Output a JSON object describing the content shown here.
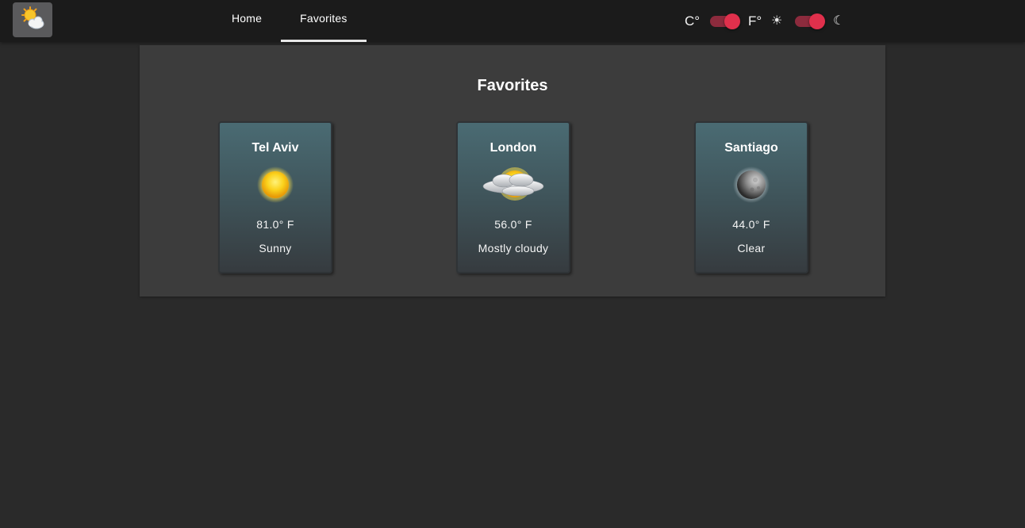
{
  "header": {
    "logo_icon": "sun-behind-cloud-icon",
    "tabs": [
      {
        "label": "Home",
        "active": false
      },
      {
        "label": "Favorites",
        "active": true
      }
    ],
    "unit_toggle": {
      "left_label": "C°",
      "right_label": "F°",
      "selected": "F°"
    },
    "theme_toggle": {
      "left_icon": "sun-icon",
      "right_icon": "moon-icon",
      "left_glyph": "☀",
      "right_glyph": "☾",
      "selected": "dark"
    }
  },
  "colors": {
    "appbar": "#1b1b1b",
    "background": "#2a2a2a",
    "panel": "#3c3c3c",
    "accent": "#e0304c",
    "tab_indicator": "#e6e6e6"
  },
  "favorites": {
    "title": "Favorites",
    "cards": [
      {
        "city": "Tel Aviv",
        "temperature": "81.0° F",
        "condition": "Sunny",
        "icon": "sun-icon"
      },
      {
        "city": "London",
        "temperature": "56.0° F",
        "condition": "Mostly cloudy",
        "icon": "mostly-cloudy-icon"
      },
      {
        "city": "Santiago",
        "temperature": "44.0° F",
        "condition": "Clear",
        "icon": "moon-icon"
      }
    ]
  }
}
